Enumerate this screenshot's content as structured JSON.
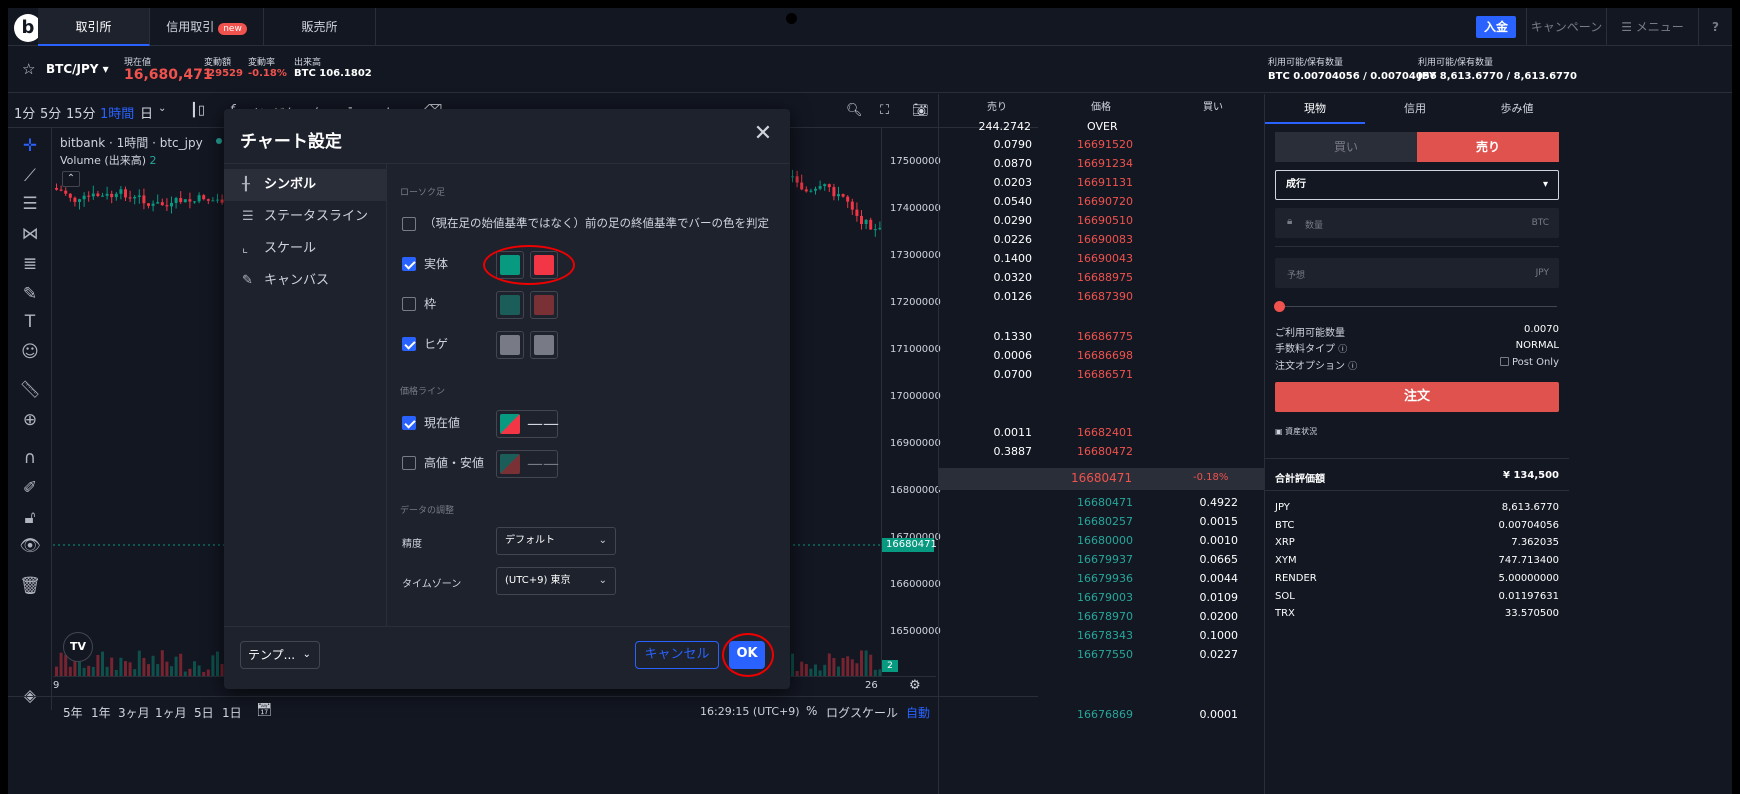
{
  "nav": {
    "logo": "b",
    "tabs": [
      {
        "label": "取引所"
      },
      {
        "label": "信用取引"
      },
      {
        "label": "販売所"
      }
    ],
    "new_badge": "new",
    "deposit": "入金",
    "campaign": "キャンペーン",
    "menu": "メニュー",
    "help": "?"
  },
  "ticker": {
    "pair": "BTC/JPY",
    "current_label": "現在値",
    "current_value": "16,680,471",
    "change_label": "変動額",
    "change_value": "-29529",
    "rate_label": "変動率",
    "rate_value": "-0.18%",
    "volume_label": "出来高",
    "volume_value": "BTC 106.1802",
    "avail1_label": "利用可能/保有数量",
    "avail1_value": "BTC 0.00704056 / 0.00704056",
    "avail2_label": "利用可能/保有数量",
    "avail2_value": "JPY 8,613.6770 / 8,613.6770"
  },
  "chart_toolbar": {
    "timeframes": [
      "1分",
      "5分",
      "15分",
      "1時間",
      "日"
    ],
    "indicator": "インジケーター"
  },
  "chart": {
    "title": "bitbank · 1時間 · btc_jpy",
    "volume_label": "Volume (出来高)",
    "volume_value": "2",
    "price_labels": [
      "17500000",
      "17400000",
      "17300000",
      "17200000",
      "17100000",
      "17000000",
      "16900000",
      "16800000",
      "16700000",
      "16600000",
      "16500000"
    ],
    "current_price_tag": "16680471",
    "volume_tag": "2",
    "time_labels": [
      "9",
      "26"
    ],
    "tv_logo": "TV"
  },
  "bottom_toolbar": {
    "ranges": [
      "5年",
      "1年",
      "3ヶ月",
      "1ヶ月",
      "5日",
      "1日"
    ],
    "clock": "16:29:15 (UTC+9)",
    "percent": "%",
    "log": "ログスケール",
    "auto": "自動"
  },
  "modal": {
    "title": "チャート設定",
    "close": "✕",
    "sidebar": [
      {
        "label": "シンボル",
        "icon": "candlestick-icon"
      },
      {
        "label": "ステータスライン",
        "icon": "lines-icon"
      },
      {
        "label": "スケール",
        "icon": "scale-icon"
      },
      {
        "label": "キャンバス",
        "icon": "pencil-icon"
      }
    ],
    "section_candles": "ローソク足",
    "prev_close_label": "（現在足の始値基準ではなく）前の足の終値基準でバーの色を判定",
    "body_label": "実体",
    "border_label": "枠",
    "wick_label": "ヒゲ",
    "section_price_line": "価格ライン",
    "current_value_label": "現在値",
    "high_low_label": "高値・安値",
    "section_data": "データの調整",
    "precision_label": "精度",
    "precision_value": "デフォルト",
    "timezone_label": "タイムゾーン",
    "timezone_value": "(UTC+9) 東京",
    "template_label": "テンプ...",
    "cancel": "キャンセル",
    "ok": "OK",
    "colors": {
      "up": "#089981",
      "down": "#f23645",
      "border_up": "#1b5e59",
      "border_down": "#7a3136",
      "wick": "#787b86"
    }
  },
  "orderbook": {
    "headers": {
      "sell": "売り",
      "price": "価格",
      "buy": "買い"
    },
    "over_qty": "244.2742",
    "over_label": "OVER",
    "asks": [
      {
        "qty": "0.0790",
        "price": "16691520"
      },
      {
        "qty": "0.0870",
        "price": "16691234"
      },
      {
        "qty": "0.0203",
        "price": "16691131"
      },
      {
        "qty": "0.0540",
        "price": "16690720"
      },
      {
        "qty": "0.0290",
        "price": "16690510"
      },
      {
        "qty": "0.0226",
        "price": "16690083"
      },
      {
        "qty": "0.1400",
        "price": "16690043"
      },
      {
        "qty": "0.0320",
        "price": "16688975"
      },
      {
        "qty": "0.0126",
        "price": "16687390"
      },
      {
        "qty": "0.1330",
        "price": "16686775"
      },
      {
        "qty": "0.0006",
        "price": "16686698"
      },
      {
        "qty": "0.0700",
        "price": "16686571"
      },
      {
        "qty": "0.0011",
        "price": "16682401"
      },
      {
        "qty": "0.3887",
        "price": "16680472"
      }
    ],
    "last_price": "16680471",
    "last_change": "-0.18%",
    "bids": [
      {
        "price": "16680471",
        "qty": "0.4922"
      },
      {
        "price": "16680257",
        "qty": "0.0015"
      },
      {
        "price": "16680000",
        "qty": "0.0010"
      },
      {
        "price": "16679937",
        "qty": "0.0665"
      },
      {
        "price": "16679936",
        "qty": "0.0044"
      },
      {
        "price": "16679003",
        "qty": "0.0109"
      },
      {
        "price": "16678970",
        "qty": "0.0200"
      },
      {
        "price": "16678343",
        "qty": "0.1000"
      },
      {
        "price": "16677550",
        "qty": "0.0227"
      },
      {
        "price": "16676869",
        "qty": "0.0001"
      }
    ]
  },
  "order_panel": {
    "tabs": [
      {
        "label": "現物"
      },
      {
        "label": "信用"
      },
      {
        "label": "歩み値"
      }
    ],
    "buy": "買い",
    "sell": "売り",
    "order_type": "成行",
    "qty_placeholder": "数量",
    "qty_unit": "BTC",
    "estimate_placeholder": "予想",
    "estimate_unit": "JPY",
    "available_label": "ご利用可能数量",
    "available_value": "0.0070",
    "fee_label": "手数料タイプ",
    "fee_value": "NORMAL",
    "option_label": "注文オプション",
    "post_only": "Post Only",
    "order_button": "注文",
    "assets_link": "資産状況",
    "total_label": "合計評価額",
    "total_value": "¥ 134,500",
    "assets": [
      {
        "name": "JPY",
        "value": "8,613.6770"
      },
      {
        "name": "BTC",
        "value": "0.00704056"
      },
      {
        "name": "XRP",
        "value": "7.362035"
      },
      {
        "name": "XYM",
        "value": "747.713400"
      },
      {
        "name": "RENDER",
        "value": "5.00000000"
      },
      {
        "name": "SOL",
        "value": "0.01197631"
      },
      {
        "name": "TRX",
        "value": "33.570500"
      }
    ]
  }
}
